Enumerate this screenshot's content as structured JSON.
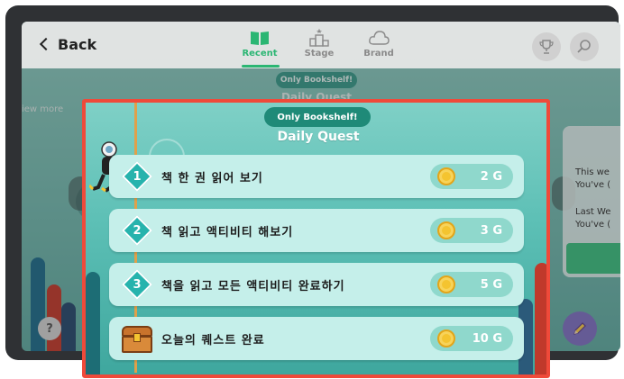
{
  "header": {
    "back_label": "Back",
    "tabs": [
      {
        "label": "Recent",
        "icon": "book-icon",
        "active": true
      },
      {
        "label": "Stage",
        "icon": "podium-icon",
        "active": false
      },
      {
        "label": "Brand",
        "icon": "cloud-icon",
        "active": false
      }
    ],
    "accent_color": "#2bb673"
  },
  "background": {
    "badge": "Only Bookshelf!",
    "title": "Daily Quest",
    "view_more": "iew more",
    "side_card_lines": [
      "This we",
      "You've (",
      "Last We",
      "You've ("
    ]
  },
  "quest_panel": {
    "badge": "Only Bookshelf!",
    "title": "Daily Quest",
    "quests": [
      {
        "number": "1",
        "label": "책 한 권 읽어 보기",
        "reward": "2 G"
      },
      {
        "number": "2",
        "label": "책 읽고 액티비티 해보기",
        "reward": "3 G"
      },
      {
        "number": "3",
        "label": "책을 읽고 모든 액티비티 완료하기",
        "reward": "5 G"
      }
    ],
    "final": {
      "label": "오늘의 퀘스트 완료",
      "reward": "10 G",
      "icon": "treasure-chest-icon"
    },
    "highlight_color": "#ef4a3a"
  },
  "help_label": "?"
}
